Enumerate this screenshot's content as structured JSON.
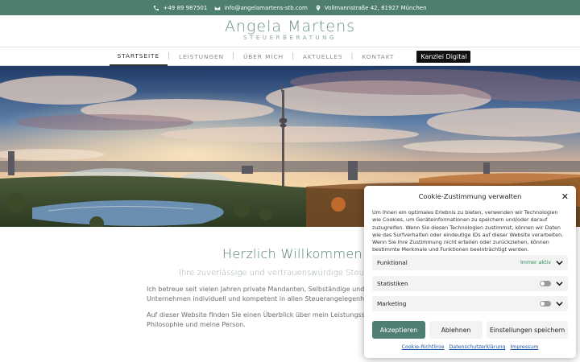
{
  "topbar": {
    "phone": "+49 89 987501",
    "email": "info@angelamartens-stb.com",
    "address": "Vollmannstraße 42, 81927 München",
    "background": "#4e7e70"
  },
  "brand": {
    "name": "Angela Martens",
    "tagline": "STEUERBERATUNG"
  },
  "nav": {
    "items": [
      {
        "label": "STARTSEITE"
      },
      {
        "label": "LEISTUNGEN"
      },
      {
        "label": "ÜBER MICH"
      },
      {
        "label": "AKTUELLES"
      },
      {
        "label": "KONTAKT"
      }
    ],
    "digital_label": "Kanzlei Digital"
  },
  "welcome": {
    "heading": "Herzlich Willkommen",
    "subheading": "Ihre zuverlässige und vertrauenswürdige Steuerberatung",
    "p1_line1": "Ich betreue seit vielen Jahren private Mandanten, Selbständige und",
    "p1_line2": "Unternehmen individuell und kompetent in allen Steuerangelegenheiten.",
    "p2_line1": "Auf dieser Website finden Sie einen Überblick über mein Leistungsspektrum, meine",
    "p2_line2": "Philosophie und meine Person."
  },
  "cookie": {
    "title": "Cookie-Zustimmung verwalten",
    "description": "Um Ihnen ein optimales Erlebnis zu bieten, verwenden wir Technologien wie Cookies, um Geräteinformationen zu speichern und/oder darauf zuzugreifen. Wenn Sie diesen Technologien zustimmst, können wir Daten wie das Surfverhalten oder eindeutige IDs auf dieser Website verarbeiten. Wenn Sie Ihre Zustimmung nicht erteilen oder zurückziehen, können bestimmte Merkmale und Funktionen beeinträchtigt werden.",
    "categories": [
      {
        "label": "Funktional",
        "status": "Immer aktiv"
      },
      {
        "label": "Statistiken"
      },
      {
        "label": "Marketing"
      }
    ],
    "accept_label": "Akzeptieren",
    "deny_label": "Ablehnen",
    "prefs_label": "Einstellungen speichern",
    "links": [
      "Cookie-Richtlinie",
      "Datenschutzerklärung",
      "Impressum"
    ],
    "accent": "#4f7f72"
  }
}
